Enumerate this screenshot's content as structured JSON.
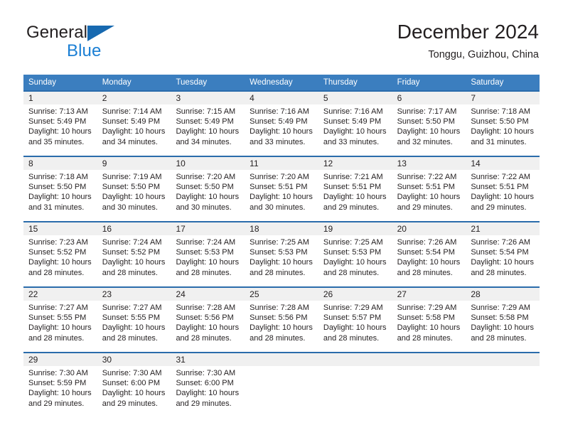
{
  "brand": {
    "name_part1": "General",
    "name_part2": "Blue",
    "logo_icon": "blue-triangle-icon",
    "colors": {
      "dark": "#231f20",
      "blue": "#1b7fd4",
      "triangle": "#1769b0"
    }
  },
  "header": {
    "title": "December 2024",
    "subtitle": "Tonggu, Guizhou, China"
  },
  "theme": {
    "header_row_background": "#3b7ebf",
    "header_row_text": "#ffffff",
    "week_divider": "#2a6cab",
    "daynumber_band": "#f0f0f0",
    "body_text": "#231f20"
  },
  "weekdays": [
    "Sunday",
    "Monday",
    "Tuesday",
    "Wednesday",
    "Thursday",
    "Friday",
    "Saturday"
  ],
  "weeks": [
    [
      {
        "day": "1",
        "sunrise": "Sunrise: 7:13 AM",
        "sunset": "Sunset: 5:49 PM",
        "daylight1": "Daylight: 10 hours",
        "daylight2": "and 35 minutes."
      },
      {
        "day": "2",
        "sunrise": "Sunrise: 7:14 AM",
        "sunset": "Sunset: 5:49 PM",
        "daylight1": "Daylight: 10 hours",
        "daylight2": "and 34 minutes."
      },
      {
        "day": "3",
        "sunrise": "Sunrise: 7:15 AM",
        "sunset": "Sunset: 5:49 PM",
        "daylight1": "Daylight: 10 hours",
        "daylight2": "and 34 minutes."
      },
      {
        "day": "4",
        "sunrise": "Sunrise: 7:16 AM",
        "sunset": "Sunset: 5:49 PM",
        "daylight1": "Daylight: 10 hours",
        "daylight2": "and 33 minutes."
      },
      {
        "day": "5",
        "sunrise": "Sunrise: 7:16 AM",
        "sunset": "Sunset: 5:49 PM",
        "daylight1": "Daylight: 10 hours",
        "daylight2": "and 33 minutes."
      },
      {
        "day": "6",
        "sunrise": "Sunrise: 7:17 AM",
        "sunset": "Sunset: 5:50 PM",
        "daylight1": "Daylight: 10 hours",
        "daylight2": "and 32 minutes."
      },
      {
        "day": "7",
        "sunrise": "Sunrise: 7:18 AM",
        "sunset": "Sunset: 5:50 PM",
        "daylight1": "Daylight: 10 hours",
        "daylight2": "and 31 minutes."
      }
    ],
    [
      {
        "day": "8",
        "sunrise": "Sunrise: 7:18 AM",
        "sunset": "Sunset: 5:50 PM",
        "daylight1": "Daylight: 10 hours",
        "daylight2": "and 31 minutes."
      },
      {
        "day": "9",
        "sunrise": "Sunrise: 7:19 AM",
        "sunset": "Sunset: 5:50 PM",
        "daylight1": "Daylight: 10 hours",
        "daylight2": "and 30 minutes."
      },
      {
        "day": "10",
        "sunrise": "Sunrise: 7:20 AM",
        "sunset": "Sunset: 5:50 PM",
        "daylight1": "Daylight: 10 hours",
        "daylight2": "and 30 minutes."
      },
      {
        "day": "11",
        "sunrise": "Sunrise: 7:20 AM",
        "sunset": "Sunset: 5:51 PM",
        "daylight1": "Daylight: 10 hours",
        "daylight2": "and 30 minutes."
      },
      {
        "day": "12",
        "sunrise": "Sunrise: 7:21 AM",
        "sunset": "Sunset: 5:51 PM",
        "daylight1": "Daylight: 10 hours",
        "daylight2": "and 29 minutes."
      },
      {
        "day": "13",
        "sunrise": "Sunrise: 7:22 AM",
        "sunset": "Sunset: 5:51 PM",
        "daylight1": "Daylight: 10 hours",
        "daylight2": "and 29 minutes."
      },
      {
        "day": "14",
        "sunrise": "Sunrise: 7:22 AM",
        "sunset": "Sunset: 5:51 PM",
        "daylight1": "Daylight: 10 hours",
        "daylight2": "and 29 minutes."
      }
    ],
    [
      {
        "day": "15",
        "sunrise": "Sunrise: 7:23 AM",
        "sunset": "Sunset: 5:52 PM",
        "daylight1": "Daylight: 10 hours",
        "daylight2": "and 28 minutes."
      },
      {
        "day": "16",
        "sunrise": "Sunrise: 7:24 AM",
        "sunset": "Sunset: 5:52 PM",
        "daylight1": "Daylight: 10 hours",
        "daylight2": "and 28 minutes."
      },
      {
        "day": "17",
        "sunrise": "Sunrise: 7:24 AM",
        "sunset": "Sunset: 5:53 PM",
        "daylight1": "Daylight: 10 hours",
        "daylight2": "and 28 minutes."
      },
      {
        "day": "18",
        "sunrise": "Sunrise: 7:25 AM",
        "sunset": "Sunset: 5:53 PM",
        "daylight1": "Daylight: 10 hours",
        "daylight2": "and 28 minutes."
      },
      {
        "day": "19",
        "sunrise": "Sunrise: 7:25 AM",
        "sunset": "Sunset: 5:53 PM",
        "daylight1": "Daylight: 10 hours",
        "daylight2": "and 28 minutes."
      },
      {
        "day": "20",
        "sunrise": "Sunrise: 7:26 AM",
        "sunset": "Sunset: 5:54 PM",
        "daylight1": "Daylight: 10 hours",
        "daylight2": "and 28 minutes."
      },
      {
        "day": "21",
        "sunrise": "Sunrise: 7:26 AM",
        "sunset": "Sunset: 5:54 PM",
        "daylight1": "Daylight: 10 hours",
        "daylight2": "and 28 minutes."
      }
    ],
    [
      {
        "day": "22",
        "sunrise": "Sunrise: 7:27 AM",
        "sunset": "Sunset: 5:55 PM",
        "daylight1": "Daylight: 10 hours",
        "daylight2": "and 28 minutes."
      },
      {
        "day": "23",
        "sunrise": "Sunrise: 7:27 AM",
        "sunset": "Sunset: 5:55 PM",
        "daylight1": "Daylight: 10 hours",
        "daylight2": "and 28 minutes."
      },
      {
        "day": "24",
        "sunrise": "Sunrise: 7:28 AM",
        "sunset": "Sunset: 5:56 PM",
        "daylight1": "Daylight: 10 hours",
        "daylight2": "and 28 minutes."
      },
      {
        "day": "25",
        "sunrise": "Sunrise: 7:28 AM",
        "sunset": "Sunset: 5:56 PM",
        "daylight1": "Daylight: 10 hours",
        "daylight2": "and 28 minutes."
      },
      {
        "day": "26",
        "sunrise": "Sunrise: 7:29 AM",
        "sunset": "Sunset: 5:57 PM",
        "daylight1": "Daylight: 10 hours",
        "daylight2": "and 28 minutes."
      },
      {
        "day": "27",
        "sunrise": "Sunrise: 7:29 AM",
        "sunset": "Sunset: 5:58 PM",
        "daylight1": "Daylight: 10 hours",
        "daylight2": "and 28 minutes."
      },
      {
        "day": "28",
        "sunrise": "Sunrise: 7:29 AM",
        "sunset": "Sunset: 5:58 PM",
        "daylight1": "Daylight: 10 hours",
        "daylight2": "and 28 minutes."
      }
    ],
    [
      {
        "day": "29",
        "sunrise": "Sunrise: 7:30 AM",
        "sunset": "Sunset: 5:59 PM",
        "daylight1": "Daylight: 10 hours",
        "daylight2": "and 29 minutes."
      },
      {
        "day": "30",
        "sunrise": "Sunrise: 7:30 AM",
        "sunset": "Sunset: 6:00 PM",
        "daylight1": "Daylight: 10 hours",
        "daylight2": "and 29 minutes."
      },
      {
        "day": "31",
        "sunrise": "Sunrise: 7:30 AM",
        "sunset": "Sunset: 6:00 PM",
        "daylight1": "Daylight: 10 hours",
        "daylight2": "and 29 minutes."
      },
      {
        "day": "",
        "sunrise": "",
        "sunset": "",
        "daylight1": "",
        "daylight2": ""
      },
      {
        "day": "",
        "sunrise": "",
        "sunset": "",
        "daylight1": "",
        "daylight2": ""
      },
      {
        "day": "",
        "sunrise": "",
        "sunset": "",
        "daylight1": "",
        "daylight2": ""
      },
      {
        "day": "",
        "sunrise": "",
        "sunset": "",
        "daylight1": "",
        "daylight2": ""
      }
    ]
  ]
}
